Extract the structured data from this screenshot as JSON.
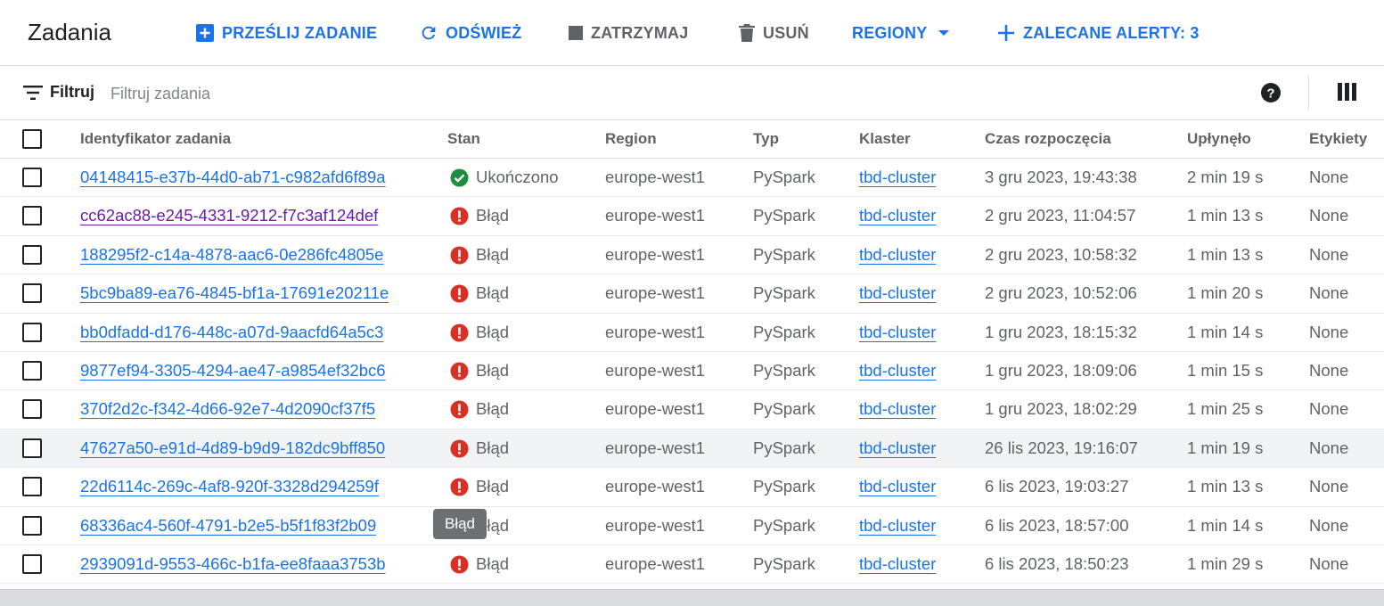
{
  "header": {
    "title": "Zadania",
    "submit_label": "PRZEŚLIJ ZADANIE",
    "refresh_label": "ODŚWIEŻ",
    "stop_label": "ZATRZYMAJ",
    "delete_label": "USUŃ",
    "regions_label": "REGIONY",
    "alerts_label": "ZALECANE ALERTY: 3"
  },
  "filter": {
    "label": "Filtruj",
    "placeholder": "Filtruj zadania"
  },
  "table": {
    "columns": [
      "Identyfikator zadania",
      "Stan",
      "Region",
      "Typ",
      "Klaster",
      "Czas rozpoczęcia",
      "Upłynęło",
      "Etykiety"
    ],
    "rows": [
      {
        "id": "04148415-e37b-44d0-ab71-c982afd6f89a",
        "status": "Ukończono",
        "status_icon": "check-circle-icon",
        "region": "europe-west1",
        "type": "PySpark",
        "cluster": "tbd-cluster",
        "start": "3 gru 2023, 19:43:38",
        "elapsed": "2 min 19 s",
        "labels": "None"
      },
      {
        "id": "cc62ac88-e245-4331-9212-f7c3af124def",
        "status": "Błąd",
        "status_icon": "error-icon",
        "region": "europe-west1",
        "type": "PySpark",
        "cluster": "tbd-cluster",
        "start": "2 gru 2023, 11:04:57",
        "elapsed": "1 min 13 s",
        "labels": "None"
      },
      {
        "id": "188295f2-c14a-4878-aac6-0e286fc4805e",
        "status": "Błąd",
        "status_icon": "error-icon",
        "region": "europe-west1",
        "type": "PySpark",
        "cluster": "tbd-cluster",
        "start": "2 gru 2023, 10:58:32",
        "elapsed": "1 min 13 s",
        "labels": "None"
      },
      {
        "id": "5bc9ba89-ea76-4845-bf1a-17691e20211e",
        "status": "Błąd",
        "status_icon": "error-icon",
        "region": "europe-west1",
        "type": "PySpark",
        "cluster": "tbd-cluster",
        "start": "2 gru 2023, 10:52:06",
        "elapsed": "1 min 20 s",
        "labels": "None"
      },
      {
        "id": "bb0dfadd-d176-448c-a07d-9aacfd64a5c3",
        "status": "Błąd",
        "status_icon": "error-icon",
        "region": "europe-west1",
        "type": "PySpark",
        "cluster": "tbd-cluster",
        "start": "1 gru 2023, 18:15:32",
        "elapsed": "1 min 14 s",
        "labels": "None"
      },
      {
        "id": "9877ef94-3305-4294-ae47-a9854ef32bc6",
        "status": "Błąd",
        "status_icon": "error-icon",
        "region": "europe-west1",
        "type": "PySpark",
        "cluster": "tbd-cluster",
        "start": "1 gru 2023, 18:09:06",
        "elapsed": "1 min 15 s",
        "labels": "None"
      },
      {
        "id": "370f2d2c-f342-4d66-92e7-4d2090cf37f5",
        "status": "Błąd",
        "status_icon": "error-icon",
        "region": "europe-west1",
        "type": "PySpark",
        "cluster": "tbd-cluster",
        "start": "1 gru 2023, 18:02:29",
        "elapsed": "1 min 25 s",
        "labels": "None"
      },
      {
        "id": "47627a50-e91d-4d89-b9d9-182dc9bff850",
        "status": "Błąd",
        "status_icon": "error-icon",
        "region": "europe-west1",
        "type": "PySpark",
        "cluster": "tbd-cluster",
        "start": "26 lis 2023, 19:16:07",
        "elapsed": "1 min 19 s",
        "labels": "None"
      },
      {
        "id": "22d6114c-269c-4af8-920f-3328d294259f",
        "status": "Błąd",
        "status_icon": "error-icon",
        "region": "europe-west1",
        "type": "PySpark",
        "cluster": "tbd-cluster",
        "start": "6 lis 2023, 19:03:27",
        "elapsed": "1 min 13 s",
        "labels": "None"
      },
      {
        "id": "68336ac4-560f-4791-b2e5-b5f1f83f2b09",
        "status": "Błąd",
        "status_icon": "error-icon",
        "region": "europe-west1",
        "type": "PySpark",
        "cluster": "tbd-cluster",
        "start": "6 lis 2023, 18:57:00",
        "elapsed": "1 min 14 s",
        "labels": "None"
      },
      {
        "id": "2939091d-9553-466c-b1fa-ee8faaa3753b",
        "status": "Błąd",
        "status_icon": "error-icon",
        "region": "europe-west1",
        "type": "PySpark",
        "cluster": "tbd-cluster",
        "start": "6 lis 2023, 18:50:23",
        "elapsed": "1 min 29 s",
        "labels": "None"
      }
    ]
  },
  "tooltip": {
    "text": "Błąd"
  },
  "colors": {
    "accent": "#1a73e8",
    "visited_link": "#681da8",
    "success": "#1e8e3e",
    "error": "#d93025",
    "tooltip_bg": "#6c7073"
  }
}
